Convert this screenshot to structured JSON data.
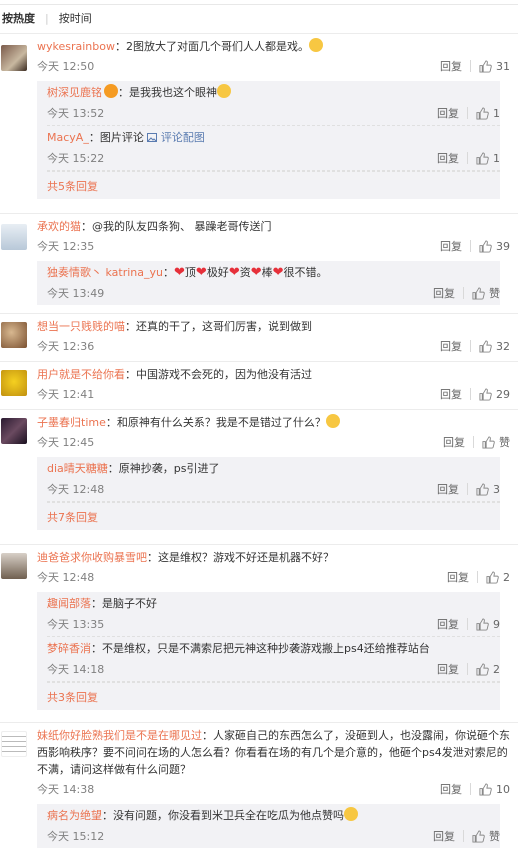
{
  "tabs": [
    "按热度",
    "按时间"
  ],
  "reply_label": "回复",
  "comments": [
    {
      "user": "wykesrainbow",
      "text": "：2图放大了对面几个哥们人人都是戏。",
      "time": "今天 12:50",
      "likes": "31",
      "replies": [
        {
          "user": "树深见鹿铭",
          "text": "：是我我也这个眼神",
          "time": "今天 13:52",
          "likes": "1"
        },
        {
          "user": "MacyA_",
          "text": "：图片评论",
          "img_link": "评论配图",
          "time": "今天 15:22",
          "likes": "1"
        }
      ],
      "more": "共5条回复"
    },
    {
      "user": "承欢的猫",
      "text": "：@我的队友四条狗、 暴躁老哥传送门",
      "time": "今天 12:35",
      "likes": "39",
      "replies": [
        {
          "user": "独奏情歌丶 katrina_yu",
          "text": "：",
          "hearts": [
            "顶",
            "极好",
            "资",
            "棒",
            "很不错。"
          ],
          "time": "今天 13:49",
          "likes": "赞"
        }
      ]
    },
    {
      "user": "想当一只贱贱的喵",
      "text": "：还真的干了，这哥们厉害，说到做到",
      "time": "今天 12:36",
      "likes": "32"
    },
    {
      "user": "用户就是不给你看",
      "text": "：中国游戏不会死的，因为他没有活过",
      "time": "今天 12:41",
      "likes": "29"
    },
    {
      "user": "子墨春归time",
      "text": "：和原神有什么关系？我是不是错过了什么？",
      "time": "今天 12:45",
      "likes": "赞",
      "replies": [
        {
          "user": "dia晴天糖糖",
          "text": "：原神抄袭，ps引进了",
          "time": "今天 12:48",
          "likes": "3"
        }
      ],
      "more": "共7条回复"
    },
    {
      "user": "迪爸爸求你收购暴雪吧",
      "text": "：这是维权？游戏不好还是机器不好？",
      "time": "今天 12:48",
      "likes": "2",
      "replies": [
        {
          "user": "趣闻部落",
          "text": "：是脑子不好",
          "time": "今天 13:35",
          "likes": "9"
        },
        {
          "user": "梦碎香消",
          "text": "：不是维权，只是不满索尼把元神这种抄袭游戏搬上ps4还给推荐站台",
          "time": "今天 14:18",
          "likes": "2"
        }
      ],
      "more": "共3条回复"
    },
    {
      "user": "妹纸你好脸熟我们是不是在哪见过",
      "text": "：人家砸自己的东西怎么了，没砸到人，也没露闹，你说砸个东西影响秩序？要不问问在场的人怎么看？你看看在场的有几个是介意的，他砸个ps4发泄对索尼的不满，请问这样做有什么问题？",
      "time": "今天 14:38",
      "likes": "10",
      "replies": [
        {
          "user": "病名为绝望",
          "text": "：没有问题，你没看到米卫兵全在吃瓜为他点赞吗",
          "time": "今天 15:12",
          "likes": "赞"
        }
      ]
    }
  ]
}
